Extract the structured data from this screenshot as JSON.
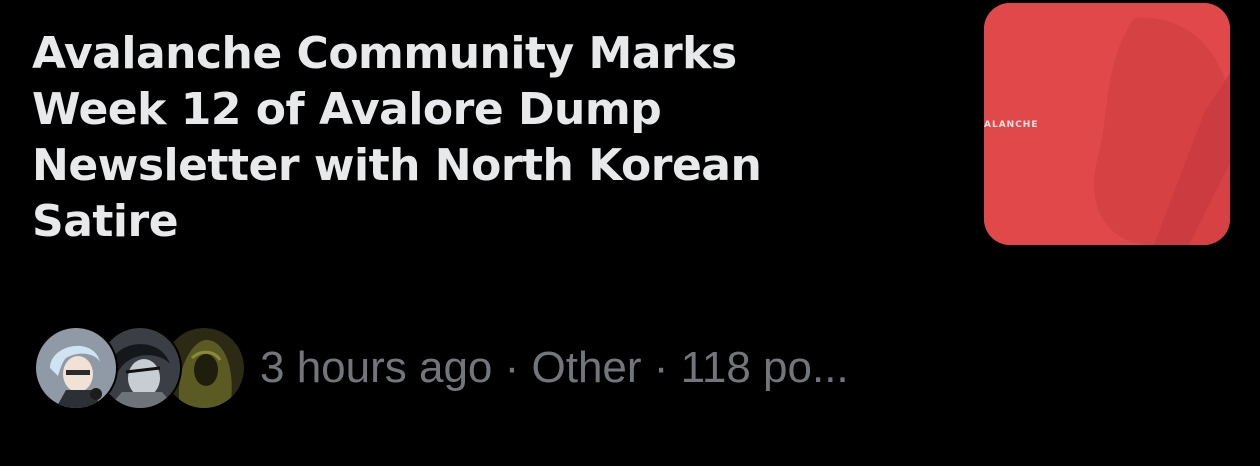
{
  "post": {
    "title_lines": [
      "Avalanche Community Marks",
      "Week 12 of Avalore Dump",
      "Newsletter with North Korean",
      "Satire"
    ],
    "thumbnail": {
      "label": "ALANCHE",
      "color": "#e0484a"
    },
    "meta": {
      "time": "3 hours ago",
      "separator": " · ",
      "category": "Other",
      "posts": "118 po..."
    }
  }
}
